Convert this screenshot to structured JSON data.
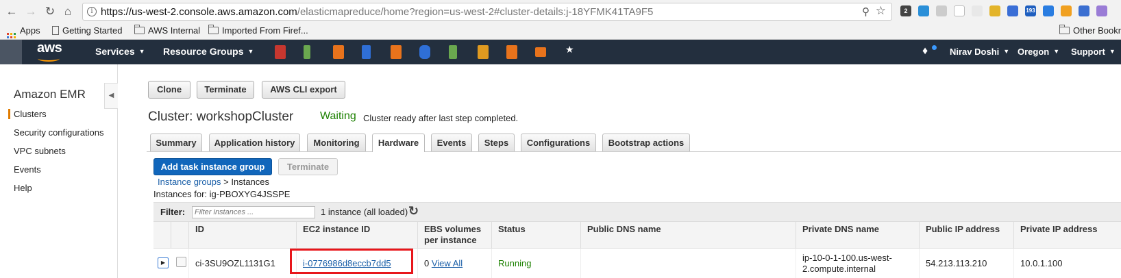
{
  "browser": {
    "url_host": "https://us-west-2.console.aws.amazon.com",
    "url_path": "/elasticmapreduce/home?region=us-west-2#cluster-details:j-18YFMK41TA9F5",
    "bookmarks": [
      "Apps",
      "Getting Started",
      "AWS Internal",
      "Imported From Firef...",
      "Other Bookm"
    ],
    "extension_badge": "2",
    "extension_count": "193"
  },
  "aws_header": {
    "logo": "aws",
    "services": "Services",
    "resource_groups": "Resource Groups",
    "user": "Nirav Doshi",
    "region": "Oregon",
    "support": "Support"
  },
  "sidebar": {
    "title": "Amazon EMR",
    "items": [
      "Clusters",
      "Security configurations",
      "VPC subnets",
      "Events",
      "Help"
    ],
    "active_item": "Clusters"
  },
  "toolbar": {
    "clone": "Clone",
    "terminate": "Terminate",
    "cli_export": "AWS CLI export"
  },
  "cluster": {
    "title": "Cluster: workshopCluster",
    "state": "Waiting",
    "message": "Cluster ready after last step completed."
  },
  "tabs": [
    "Summary",
    "Application history",
    "Monitoring",
    "Hardware",
    "Events",
    "Steps",
    "Configurations",
    "Bootstrap actions"
  ],
  "active_tab": "Hardware",
  "actions": {
    "add_task": "Add task instance group",
    "terminate": "Terminate"
  },
  "breadcrumb": {
    "link": "Instance groups",
    "separator": ">",
    "current": "Instances"
  },
  "instances_for": "Instances for: ig-PBOXYG4JSSPE",
  "filter": {
    "label": "Filter:",
    "placeholder": "Filter instances ...",
    "count": "1 instance (all loaded)"
  },
  "table": {
    "columns": [
      "ID",
      "EC2 instance ID",
      "EBS volumes per instance",
      "Status",
      "Public DNS name",
      "Private DNS name",
      "Public IP address",
      "Private IP address"
    ],
    "rows": [
      {
        "id": "ci-3SU9OZL1131G1",
        "ec2_id": "i-0776986d8eccb7dd5",
        "ebs_count": "0",
        "ebs_link": "View All",
        "status": "Running",
        "public_dns": "",
        "private_dns": "ip-10-0-1-100.us-west-2.compute.internal",
        "public_ip": "54.213.113.210",
        "private_ip": "10.0.1.100"
      }
    ]
  },
  "colors": {
    "aws_header": "#232f3e",
    "aws_orange": "#ff9900",
    "primary_button": "#1166bb",
    "status_green": "#1d8102",
    "link": "#1a5fa8",
    "highlight_box": "#e8161b"
  }
}
